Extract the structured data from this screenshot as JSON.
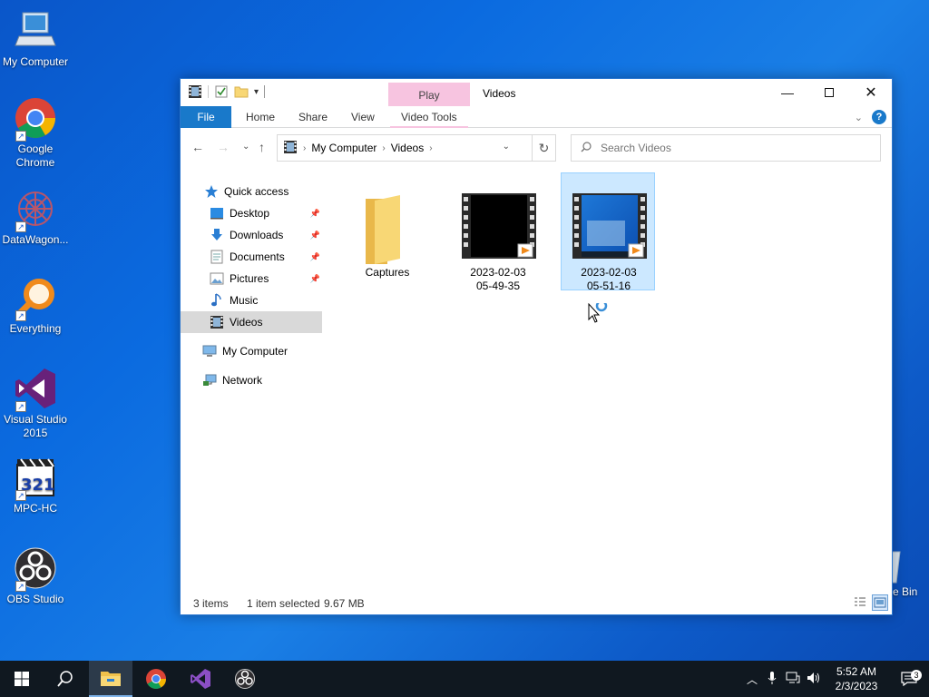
{
  "desktop": {
    "icons": [
      {
        "label": "My Computer",
        "icon": "computer-icon"
      },
      {
        "label": "Google Chrome",
        "icon": "chrome-icon"
      },
      {
        "label": "DataWagon...",
        "icon": "datawagon-icon"
      },
      {
        "label": "Everything",
        "icon": "search-magnifier-icon"
      },
      {
        "label": "Visual Studio 2015",
        "icon": "visual-studio-icon"
      },
      {
        "label": "MPC-HC",
        "icon": "mpc-hc-icon"
      },
      {
        "label": "OBS Studio",
        "icon": "obs-icon"
      }
    ],
    "recycle_bin_label": "e Bin"
  },
  "window": {
    "title": "Videos",
    "contextual_tab": "Play",
    "tabs": [
      "File",
      "Home",
      "Share",
      "View",
      "Video Tools"
    ],
    "address": {
      "parts": [
        "My Computer",
        "Videos"
      ]
    },
    "search_placeholder": "Search Videos",
    "nav_pane": {
      "quick_access": "Quick access",
      "items": [
        {
          "label": "Desktop",
          "pinned": true
        },
        {
          "label": "Downloads",
          "pinned": true
        },
        {
          "label": "Documents",
          "pinned": true
        },
        {
          "label": "Pictures",
          "pinned": true
        },
        {
          "label": "Music",
          "pinned": false
        },
        {
          "label": "Videos",
          "pinned": false,
          "selected": true
        }
      ],
      "my_computer": "My Computer",
      "network": "Network"
    },
    "files": [
      {
        "name": "Captures",
        "type": "folder"
      },
      {
        "name_line1": "2023-02-03",
        "name_line2": "05-49-35",
        "type": "video",
        "thumb": "black"
      },
      {
        "name_line1": "2023-02-03",
        "name_line2": "05-51-16",
        "type": "video",
        "thumb": "desktop",
        "selected": true
      }
    ],
    "status": {
      "items": "3 items",
      "selected": "1 item selected",
      "size": "9.67 MB"
    }
  },
  "taskbar": {
    "apps": [
      "start-icon",
      "search-icon",
      "file-explorer-icon",
      "chrome-icon",
      "visual-studio-icon",
      "obs-icon"
    ],
    "clock_time": "5:52 AM",
    "clock_date": "2/3/2023",
    "notification_count": "3"
  },
  "colors": {
    "accent": "#1979ca",
    "selection": "#cce8ff",
    "contextual": "#f7c4e0"
  }
}
